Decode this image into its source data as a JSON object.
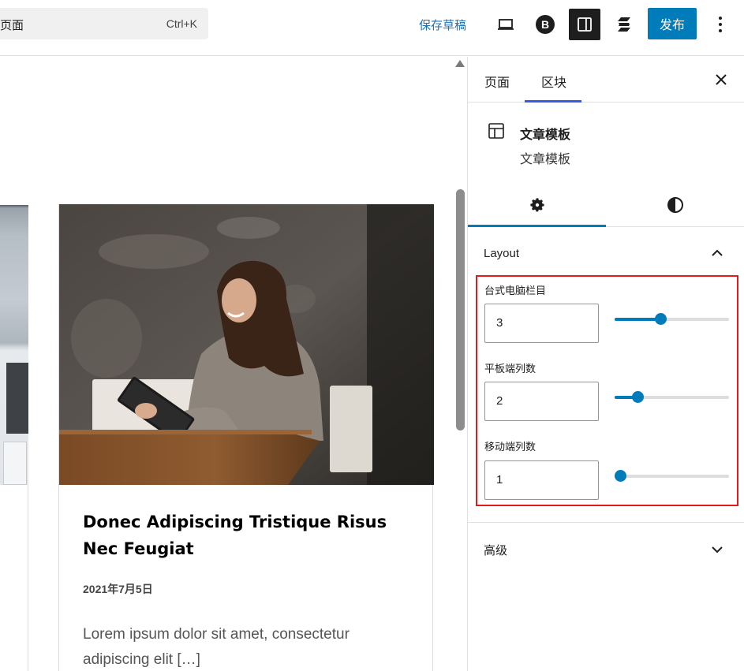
{
  "topbar": {
    "command_title": "页面",
    "command_shortcut": "Ctrl+K",
    "save_draft": "保存草稿",
    "publish": "发布"
  },
  "canvas": {
    "post": {
      "title": "Donec Adipiscing Tristique Risus Nec Feugiat",
      "date": "2021年7月5日",
      "excerpt": "Lorem ipsum dolor sit amet, consectetur adipiscing elit […]"
    }
  },
  "sidebar": {
    "tabs": [
      "页面",
      "区块"
    ],
    "active_tab": "区块",
    "block": {
      "title": "文章模板",
      "description": "文章模板"
    },
    "subtabs": [
      "settings",
      "styles"
    ],
    "layout_panel": {
      "title": "Layout",
      "controls": [
        {
          "label": "台式电脑栏目",
          "value": "3",
          "fraction": 0.4
        },
        {
          "label": "平板端列数",
          "value": "2",
          "fraction": 0.2
        },
        {
          "label": "移动端列数",
          "value": "1",
          "fraction": 0.0
        }
      ]
    },
    "advanced_panel": {
      "title": "高级"
    }
  },
  "colors": {
    "accent": "#007cba",
    "highlight": "#e21b1b",
    "link": "#2271b1"
  }
}
